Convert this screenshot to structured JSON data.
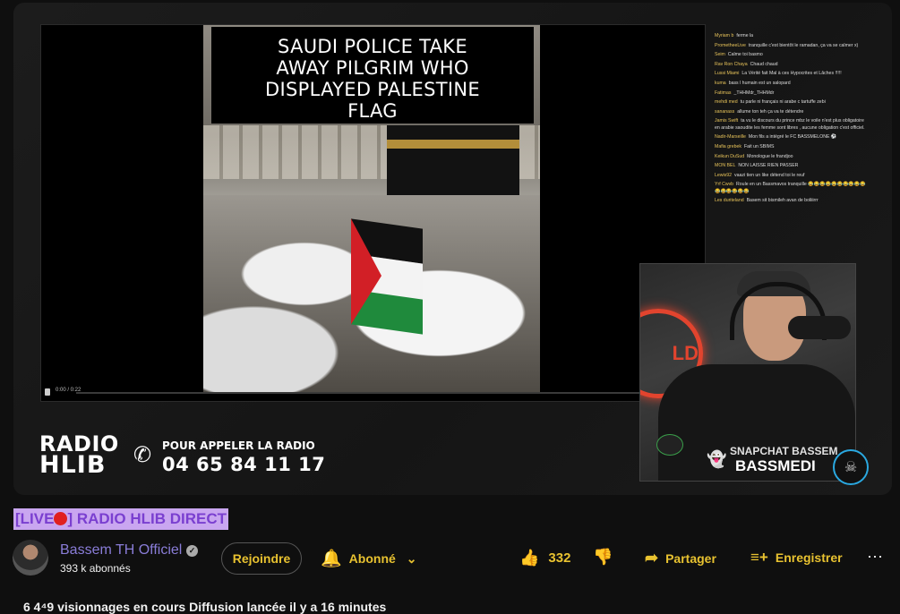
{
  "video": {
    "caption": [
      "SAUDI POLICE TAKE",
      "AWAY PILGRIM WHO",
      "DISPLAYED PALESTINE",
      "FLAG"
    ],
    "inner_time": "0:00 / 0:22"
  },
  "branding": {
    "radio_line1": "RADIO",
    "radio_line2": "HLIB",
    "call_text": "POUR APPELER LA RADIO",
    "phone_number": "04 65 84 11 17",
    "snapchat_label": "SNAPCHAT BASSEM",
    "snapchat_name": "BASSMEDI",
    "webcam_sign": "LD"
  },
  "chat": [
    {
      "author": "Myriam b",
      "text": "ferme la"
    },
    {
      "author": "PrometheeLive",
      "text": "tranquille c'est bientôt le ramadan, ça va se calmer x)"
    },
    {
      "author": "Seim",
      "text": "Calme toi basmo"
    },
    {
      "author": "Rav Ron Chaya",
      "text": "Chaud chaud"
    },
    {
      "author": "Lussi Miami",
      "text": "La Vérité fait Mal à ces Hypocrites et Lâches !!!!!"
    },
    {
      "author": "kuma",
      "text": "bass l humain est un salopard"
    },
    {
      "author": "Fatimas",
      "text": "_THHMdr_THHMdr"
    },
    {
      "author": "mehdi med",
      "text": "tu parle ni français ni arabe c tartuffe zebi"
    },
    {
      "author": "sananass",
      "text": "allume ton teh ça va te détendre"
    },
    {
      "author": "Jamis Swift",
      "text": "ta vu le discours du prince mbz le voile n'est plus obligatoire en arabie saoudite les femme sont libres , aucune obligation c'est officiel."
    },
    {
      "author": "Nadir-Marseille",
      "text": "Mon fils a intégré le FC BASSMELONE ⚽"
    },
    {
      "author": "Mafia grebek",
      "text": "Fait un SBIMS"
    },
    {
      "author": "Keikun DuSud",
      "text": "Monologue le frandjoo"
    },
    {
      "author": "MON BEL",
      "text": "NON LAISSE RIEN PASSER"
    },
    {
      "author": "Lewis92",
      "text": "vaazi tien un like détend toi le reuf"
    },
    {
      "author": "Yrf Cwvb",
      "text": "Roule en un Bassmavos tranquille 😂😂😂😂😂😂😂😂😂😂😂😂😂😂😂😂"
    },
    {
      "author": "Les duriteland",
      "text": "Basem sit bismileh avan de boliiirrr"
    }
  ],
  "title": {
    "prefix": "[LIVE",
    "suffix": "] RADIO HLIB DIRECT"
  },
  "channel": {
    "name": "Bassem TH Officiel",
    "subscribers": "393 k abonnés"
  },
  "actions": {
    "join": "Rejoindre",
    "subscribed": "Abonné",
    "like_count": "332",
    "share": "Partager",
    "save": "Enregistrer"
  },
  "stats": {
    "line": "6 4⁴9 visionnages en cours  Diffusion lancée il y a 16 minutes"
  },
  "colors": {
    "accent": "#e8c230",
    "title_bg": "#c9a6f0",
    "title_text": "#7a3fd0",
    "chat_author": "#e7c35a"
  },
  "icons": [
    "bell-icon",
    "chevron-down-icon",
    "thumbs-up-icon",
    "thumbs-down-icon",
    "share-icon",
    "playlist-add-icon",
    "more-icon",
    "verified-icon",
    "phone-icon",
    "snapchat-icon"
  ]
}
